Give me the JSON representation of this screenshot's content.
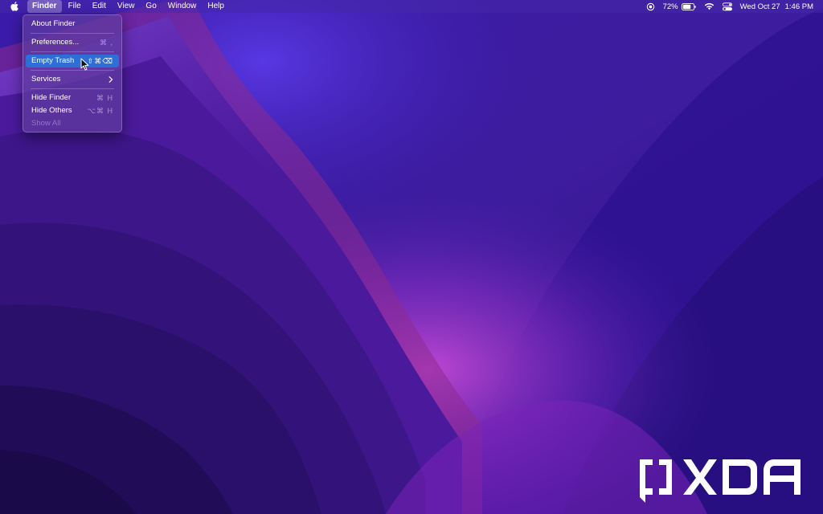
{
  "menubar": {
    "apple_icon": "apple-logo-icon",
    "app_name": "Finder",
    "menus": [
      "File",
      "Edit",
      "View",
      "Go",
      "Window",
      "Help"
    ],
    "status": {
      "screen_record_icon": "record-icon",
      "battery_percent": "72%",
      "battery_icon": "battery-icon",
      "wifi_icon": "wifi-icon",
      "control_center_icon": "control-center-icon",
      "date": "Wed Oct 27",
      "time": "1:46 PM"
    }
  },
  "finder_menu": {
    "about": "About Finder",
    "preferences": {
      "label": "Preferences...",
      "shortcut": "⌘ ,"
    },
    "empty_trash": {
      "label": "Empty Trash",
      "shortcut": "⇧⌘⌫"
    },
    "services": {
      "label": "Services",
      "submenu_icon": "chevron-right-icon"
    },
    "hide_finder": {
      "label": "Hide Finder",
      "shortcut": "⌘ H"
    },
    "hide_others": {
      "label": "Hide Others",
      "shortcut": "⌥⌘ H"
    },
    "show_all": "Show All"
  },
  "watermark": {
    "text": "XDA"
  },
  "colors": {
    "menu_highlight": "#2d6fd6",
    "wallpaper_dark": "#1c0a4f",
    "wallpaper_mid": "#4a1fa8",
    "wallpaper_glow": "#b13fd1"
  }
}
